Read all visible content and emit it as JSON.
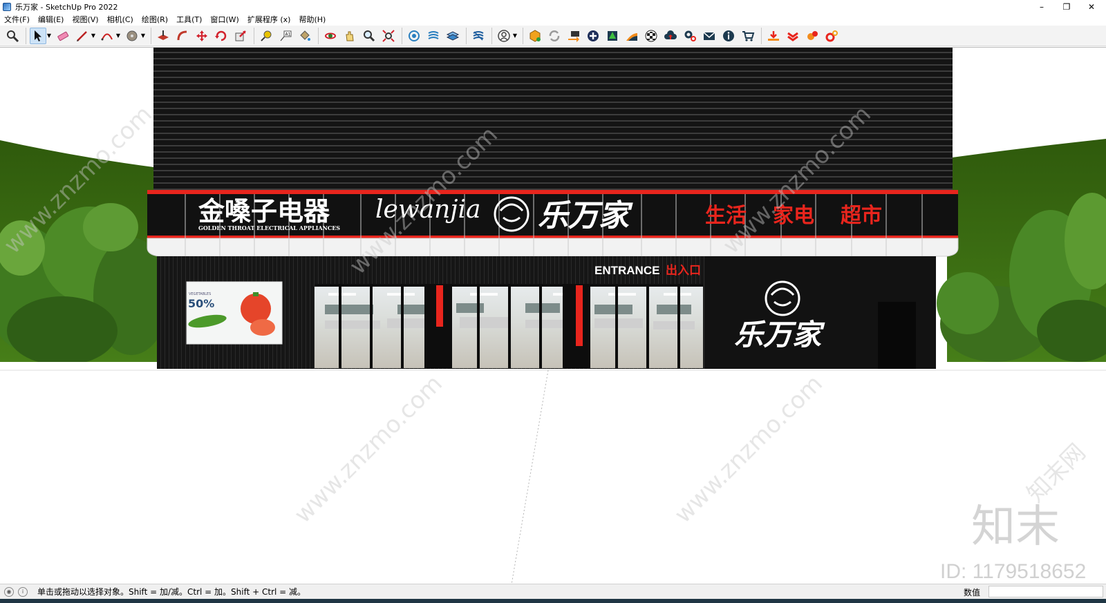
{
  "window": {
    "title": "乐万家 - SketchUp Pro 2022",
    "controls": {
      "minimize": "–",
      "restore": "❐",
      "close": "✕"
    }
  },
  "menu": [
    {
      "label": "文件(F)"
    },
    {
      "label": "编辑(E)"
    },
    {
      "label": "视图(V)"
    },
    {
      "label": "相机(C)"
    },
    {
      "label": "绘图(R)"
    },
    {
      "label": "工具(T)"
    },
    {
      "label": "窗口(W)"
    },
    {
      "label": "扩展程序 (x)"
    },
    {
      "label": "帮助(H)"
    }
  ],
  "toolbar": {
    "groups": [
      [
        "zoom-tool-icon"
      ],
      [
        "select-tool-icon",
        "eraser-icon",
        "pencil-line-icon",
        "arc-icon",
        "shape-circle-icon"
      ],
      [
        "push-pull-icon",
        "follow-me-icon",
        "move-icon",
        "rotate-icon",
        "scale-icon"
      ],
      [
        "tape-measure-icon",
        "text-label-icon",
        "paint-bucket-icon"
      ],
      [
        "orbit-icon",
        "pan-icon",
        "zoom-magnifier-icon",
        "zoom-extents-icon"
      ],
      [
        "section-plane-icon",
        "section-display-icon",
        "layers-icon",
        "outliner-icon"
      ],
      [
        "account-icon"
      ],
      [
        "extension-warehouse-icon",
        "refresh-icon",
        "transfer-icon",
        "add-circle-icon",
        "tree-icon",
        "ramp-icon",
        "checker-icon",
        "cloud-icon",
        "settings-gears-icon",
        "mail-icon",
        "info-icon",
        "cart-icon"
      ],
      [
        "download-icon",
        "chevron-stack-icon",
        "fire-gear-icon",
        "gear-orange-icon"
      ]
    ]
  },
  "scene": {
    "signage": {
      "brand_cn": "金嗓子电器",
      "brand_en": "GOLDEN THROAT ELECTRICAL APPLIANCES",
      "script_name": "lewanjia",
      "store_name": "乐万家",
      "tagline_parts": [
        "生活",
        "家电",
        "超市"
      ],
      "entrance_en": "ENTRANCE",
      "entrance_cn": "出入口",
      "side_logo_name": "乐万家"
    },
    "poster": {
      "title": "VEGETABLES",
      "discount": "50%"
    },
    "watermark": {
      "site": "www.znzmo.com",
      "brand": "知末网",
      "corner_logo": "知末",
      "id_text": "ID: 1179518652"
    },
    "colors": {
      "accent_red": "#e8251d",
      "facade_black": "#141414",
      "grass": "#3b6e12"
    }
  },
  "status": {
    "message": "单击或拖动以选择对象。Shift = 加/减。Ctrl = 加。Shift + Ctrl = 减。",
    "vcb_label": "数值",
    "vcb_value": ""
  }
}
